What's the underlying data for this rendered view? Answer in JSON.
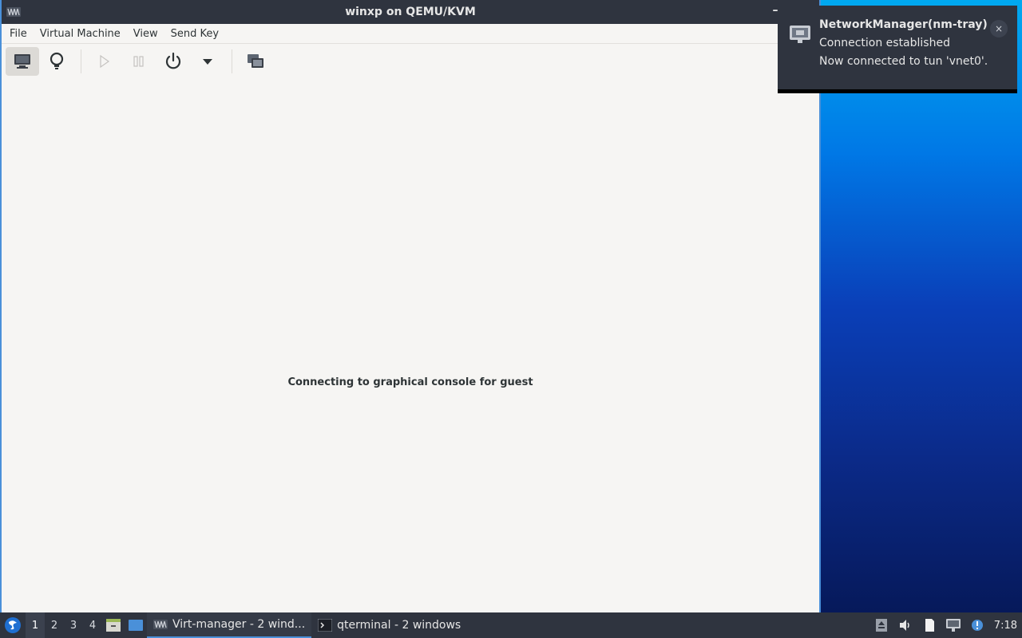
{
  "window": {
    "title": "winxp on QEMU/KVM",
    "minimize_glyph": "–"
  },
  "menu": {
    "items": [
      "File",
      "Virtual Machine",
      "View",
      "Send Key"
    ]
  },
  "toolbar": {
    "buttons": [
      {
        "name": "console-button",
        "icon": "monitor-icon"
      },
      {
        "name": "details-button",
        "icon": "lightbulb-icon"
      },
      {
        "name": "run-button",
        "icon": "play-icon"
      },
      {
        "name": "pause-button",
        "icon": "pause-icon"
      },
      {
        "name": "shutdown-button",
        "icon": "power-icon"
      },
      {
        "name": "shutdown-menu-button",
        "icon": "caret-down-icon"
      },
      {
        "name": "fullscreen-button",
        "icon": "screens-icon"
      }
    ]
  },
  "console": {
    "message": "Connecting to graphical console for guest"
  },
  "notification": {
    "title": "NetworkManager(nm-tray)",
    "line1": "Connection established",
    "line2": "Now connected to tun 'vnet0'.",
    "close_glyph": "×",
    "icon": "network-wired-icon"
  },
  "taskbar": {
    "desktops": [
      "1",
      "2",
      "3",
      "4"
    ],
    "active_desktop": "1",
    "tasks": [
      {
        "label": "Virt-manager - 2 wind...",
        "icon": "virt-manager-icon",
        "active": true
      },
      {
        "label": "qterminal - 2 windows",
        "icon": "terminal-icon",
        "active": false
      }
    ],
    "clock": "7:18"
  },
  "colors": {
    "titlebar": "#2f343f",
    "window_bg": "#f6f5f3",
    "accent": "#4a90d9"
  }
}
